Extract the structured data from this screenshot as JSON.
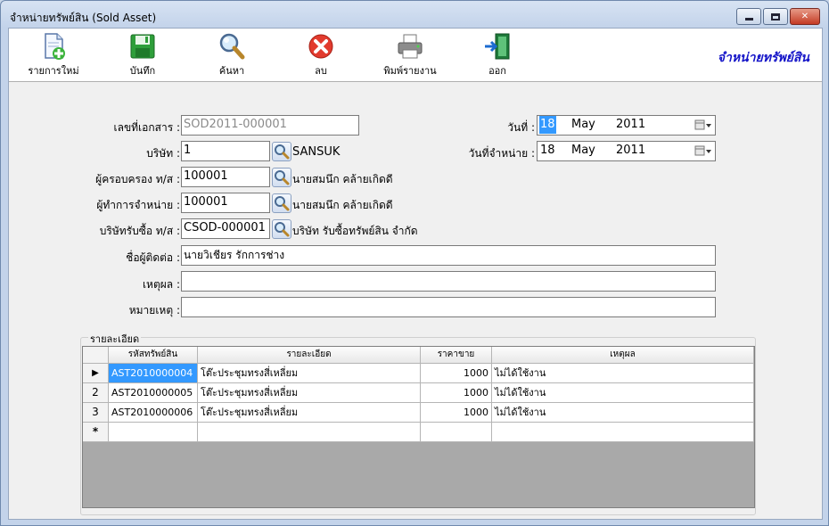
{
  "window": {
    "title": "จำหน่ายทรัพย์สิน (Sold Asset)"
  },
  "toolbar": {
    "new_label": "รายการใหม่",
    "save_label": "บันทึก",
    "search_label": "ค้นหา",
    "delete_label": "ลบ",
    "print_label": "พิมพ์รายงาน",
    "exit_label": "ออก",
    "brand_title": "จำหน่ายทรัพย์สิน"
  },
  "form": {
    "doc_no_label": "เลขที่เอกสาร :",
    "doc_no_value": "SOD2011-000001",
    "company_label": "บริษัท :",
    "company_value": "1",
    "company_name": "SANSUK",
    "custodian_label": "ผู้ครอบครอง ท/ส :",
    "custodian_value": "100001",
    "custodian_name": "นายสมนึก  คล้ายเกิดดี",
    "seller_label": "ผู้ทำการจำหน่าย :",
    "seller_value": "100001",
    "seller_name": "นายสมนึก  คล้ายเกิดดี",
    "buyer_label": "บริษัทรับซื้อ ท/ส :",
    "buyer_value": "CSOD-000001",
    "buyer_name": "บริษัท รับซื้อทรัพย์สิน จำกัด",
    "contact_label": "ชื่อผู้ติดต่อ :",
    "contact_value": "นายวิเชียร  รักการช่าง",
    "reason_label": "เหตุผล :",
    "reason_value": "",
    "note_label": "หมายเหตุ :",
    "note_value": "",
    "date_label": "วันที่ :",
    "date_day": "18",
    "date_month": "May",
    "date_year": "2011",
    "sold_date_label": "วันที่จำหน่าย :",
    "sold_day": "18",
    "sold_month": "May",
    "sold_year": "2011"
  },
  "details": {
    "group_label": "รายละเอียด",
    "columns": [
      "รหัสทรัพย์สิน",
      "รายละเอียด",
      "ราคาขาย",
      "เหตุผล"
    ],
    "rows": [
      {
        "marker": "▶",
        "code": "AST2010000004",
        "desc": "โต๊ะประชุมทรงสี่เหลี่ยม",
        "price": "1000",
        "reason": "ไม่ได้ใช้งาน"
      },
      {
        "marker": "2",
        "code": "AST2010000005",
        "desc": "โต๊ะประชุมทรงสี่เหลี่ยม",
        "price": "1000",
        "reason": "ไม่ได้ใช้งาน"
      },
      {
        "marker": "3",
        "code": "AST2010000006",
        "desc": "โต๊ะประชุมทรงสี่เหลี่ยม",
        "price": "1000",
        "reason": "ไม่ได้ใช้งาน"
      }
    ],
    "new_row_marker": "*"
  },
  "icons": {
    "new": "new-document-icon",
    "save": "floppy-disk-icon",
    "search": "magnifier-icon",
    "delete": "red-x-icon",
    "print": "printer-icon",
    "exit": "exit-door-icon"
  },
  "colors": {
    "brand_title": "#1515c8",
    "selection": "#3399ff"
  }
}
